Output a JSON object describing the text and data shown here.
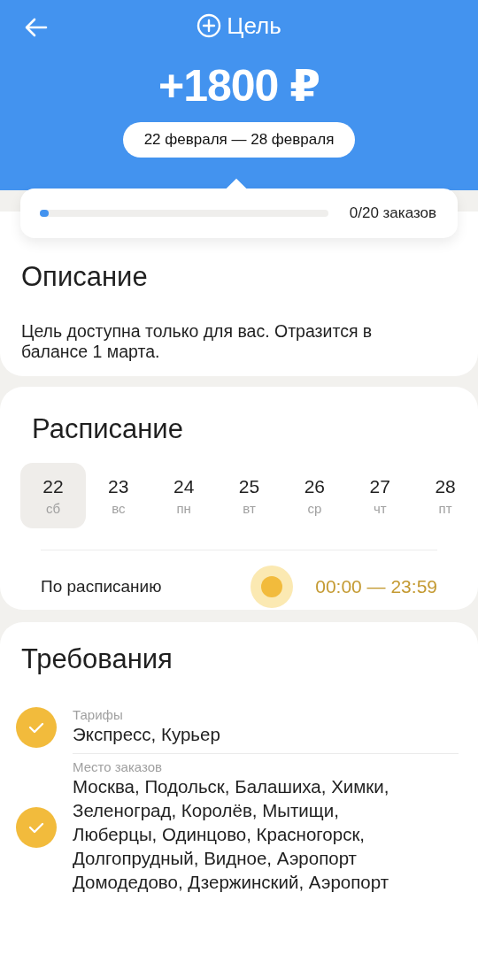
{
  "header": {
    "title": "Цель",
    "amount": "+1800 ₽",
    "period": "22 февраля — 28 февраля"
  },
  "progress": {
    "level": 0.02,
    "reading": "0/20 заказов"
  },
  "description": {
    "title": "Описание",
    "text": "Цель доступна только для вас. Отразится в балансе 1 марта."
  },
  "schedule": {
    "title": "Расписание",
    "days": [
      {
        "date": "22",
        "weekday": "сб",
        "selected": true
      },
      {
        "date": "23",
        "weekday": "вс",
        "selected": false
      },
      {
        "date": "24",
        "weekday": "пн",
        "selected": false
      },
      {
        "date": "25",
        "weekday": "вт",
        "selected": false
      },
      {
        "date": "26",
        "weekday": "ср",
        "selected": false
      },
      {
        "date": "27",
        "weekday": "чт",
        "selected": false
      },
      {
        "date": "28",
        "weekday": "пт",
        "selected": false
      }
    ],
    "mode": "По расписанию",
    "time": "00:00 — 23:59"
  },
  "requirements": {
    "title": "Требования",
    "items": [
      {
        "label": "Тарифы",
        "value": "Экспресс, Курьер",
        "done": true
      },
      {
        "label": "Место заказов",
        "value": "Москва, Подольск, Балашиха, Химки, Зеленоград, Королёв, Мытищи, Люберцы, Одинцово, Красногорск, Долгопрудный, Видное, Аэропорт Домодедово, Дзержинский, Аэропорт",
        "done": true
      }
    ]
  }
}
